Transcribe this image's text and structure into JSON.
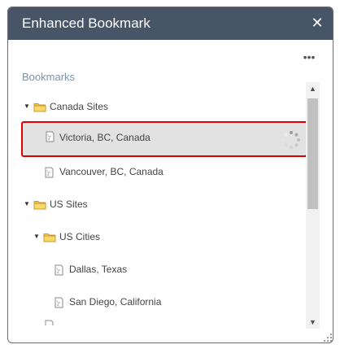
{
  "window": {
    "title": "Enhanced Bookmark",
    "close_icon": "close-icon",
    "more_icon": "ellipsis-icon"
  },
  "section": {
    "label": "Bookmarks"
  },
  "tree": {
    "items": [
      {
        "type": "folder",
        "label": "Canada Sites",
        "expanded": true
      },
      {
        "type": "bookmark",
        "label": "Victoria, BC, Canada",
        "selected": true,
        "loading": true
      },
      {
        "type": "bookmark",
        "label": "Vancouver, BC, Canada"
      },
      {
        "type": "folder",
        "label": "US Sites",
        "expanded": true
      },
      {
        "type": "folder",
        "label": "US Cities",
        "expanded": true
      },
      {
        "type": "bookmark",
        "label": "Dallas, Texas"
      },
      {
        "type": "bookmark",
        "label": "San Diego, California"
      }
    ]
  },
  "colors": {
    "titlebar": "#485566",
    "selection_outline": "#e00000",
    "selection_fill": "#e2e2e2",
    "section_label": "#7f93a6",
    "folder": "#f2c94c"
  }
}
